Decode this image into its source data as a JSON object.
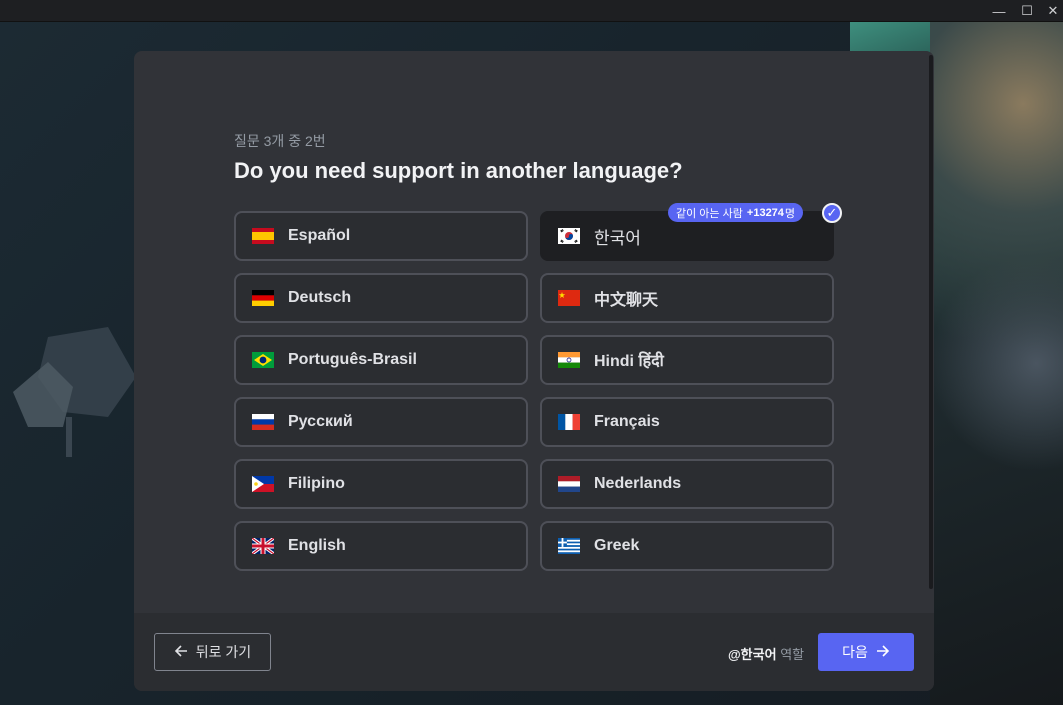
{
  "window": {
    "minimize": "—",
    "maximize": "☐",
    "close": "✕"
  },
  "step": "질문 3개 중 2번",
  "question": "Do you need support in another language?",
  "options": [
    {
      "label": "Español",
      "flag": "es"
    },
    {
      "label": "한국어",
      "flag": "kr",
      "selected": true
    },
    {
      "label": "Deutsch",
      "flag": "de"
    },
    {
      "label": "中文聊天",
      "flag": "cn"
    },
    {
      "label": "Português-Brasil",
      "flag": "br"
    },
    {
      "label": "Hindi हिंदी",
      "flag": "in"
    },
    {
      "label": "Русский",
      "flag": "ru"
    },
    {
      "label": "Français",
      "flag": "fr"
    },
    {
      "label": "Filipino",
      "flag": "ph"
    },
    {
      "label": "Nederlands",
      "flag": "nl"
    },
    {
      "label": "English",
      "flag": "gb"
    },
    {
      "label": "Greek",
      "flag": "gr"
    }
  ],
  "badge": {
    "prefix": "같이 아는 사람",
    "count": "+13274",
    "suffix": "명"
  },
  "footer": {
    "back_label": "뒤로 가기",
    "role_mention": "@한국어",
    "role_suffix": "역할",
    "next_label": "다음"
  },
  "colors": {
    "accent": "#5865f2",
    "modal": "#313338",
    "footer": "#2b2d31"
  }
}
